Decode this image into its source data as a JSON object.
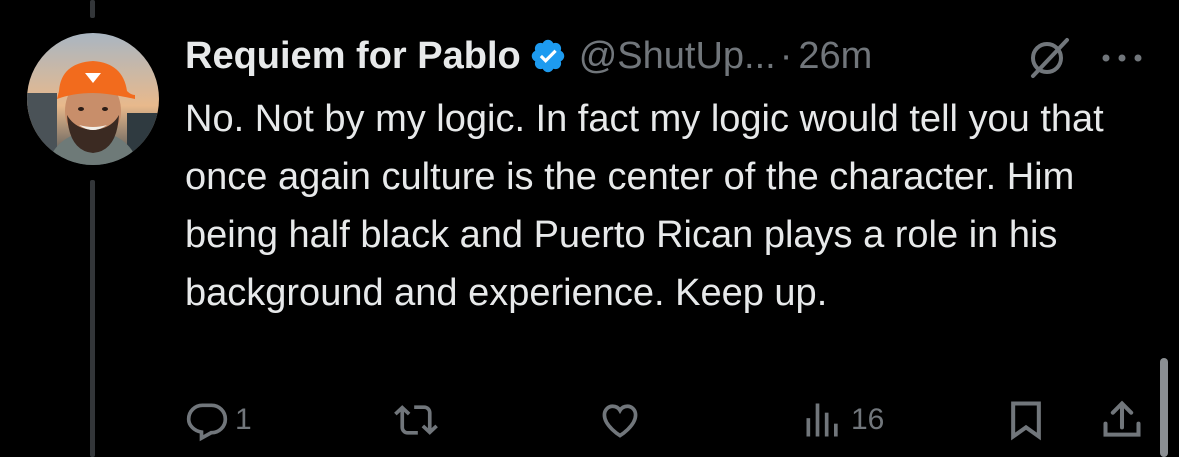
{
  "tweet": {
    "display_name": "Requiem for Pablo",
    "handle": "@ShutUp...",
    "separator": "·",
    "time": "26m",
    "verified": true,
    "verified_color": "#1d9bf0",
    "text": "No. Not by my logic. In fact my logic would tell you that once again culture is the center of the character. Him being half black and Puerto Rican plays a role in his background and experience. Keep up."
  },
  "actions": {
    "replies": "1",
    "reposts": "",
    "likes": "",
    "views": "16"
  },
  "icons": {
    "header": [
      "grok-icon",
      "more-icon"
    ],
    "actions": [
      "reply-icon",
      "repost-icon",
      "like-icon",
      "views-icon",
      "bookmark-icon",
      "share-icon"
    ]
  },
  "colors": {
    "background": "#000000",
    "text": "#e7e9ea",
    "secondary": "#71767b"
  }
}
